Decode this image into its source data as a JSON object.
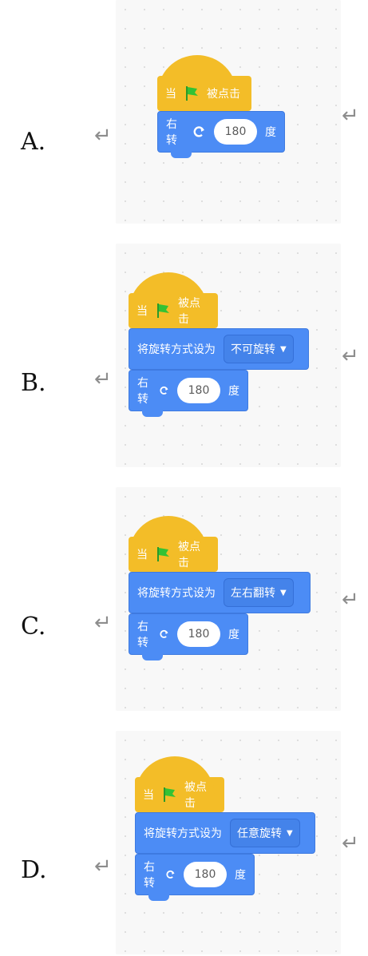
{
  "options": [
    {
      "letter": "A.",
      "hat": {
        "prefix": "当",
        "suffix": "被点击"
      },
      "commands": [
        {
          "type": "turn",
          "label": "右转",
          "value": "180",
          "unit": "度"
        }
      ]
    },
    {
      "letter": "B.",
      "hat": {
        "prefix": "当",
        "suffix": "被点击"
      },
      "commands": [
        {
          "type": "rotation-style",
          "label": "将旋转方式设为",
          "dropdown": "不可旋转"
        },
        {
          "type": "turn",
          "label": "右转",
          "value": "180",
          "unit": "度"
        }
      ]
    },
    {
      "letter": "C.",
      "hat": {
        "prefix": "当",
        "suffix": "被点击"
      },
      "commands": [
        {
          "type": "rotation-style",
          "label": "将旋转方式设为",
          "dropdown": "左右翻转"
        },
        {
          "type": "turn",
          "label": "右转",
          "value": "180",
          "unit": "度"
        }
      ]
    },
    {
      "letter": "D.",
      "hat": {
        "prefix": "当",
        "suffix": "被点击"
      },
      "commands": [
        {
          "type": "rotation-style",
          "label": "将旋转方式设为",
          "dropdown": "任意旋转"
        },
        {
          "type": "turn",
          "label": "右转",
          "value": "180",
          "unit": "度"
        }
      ]
    }
  ],
  "return_mark": "↵"
}
